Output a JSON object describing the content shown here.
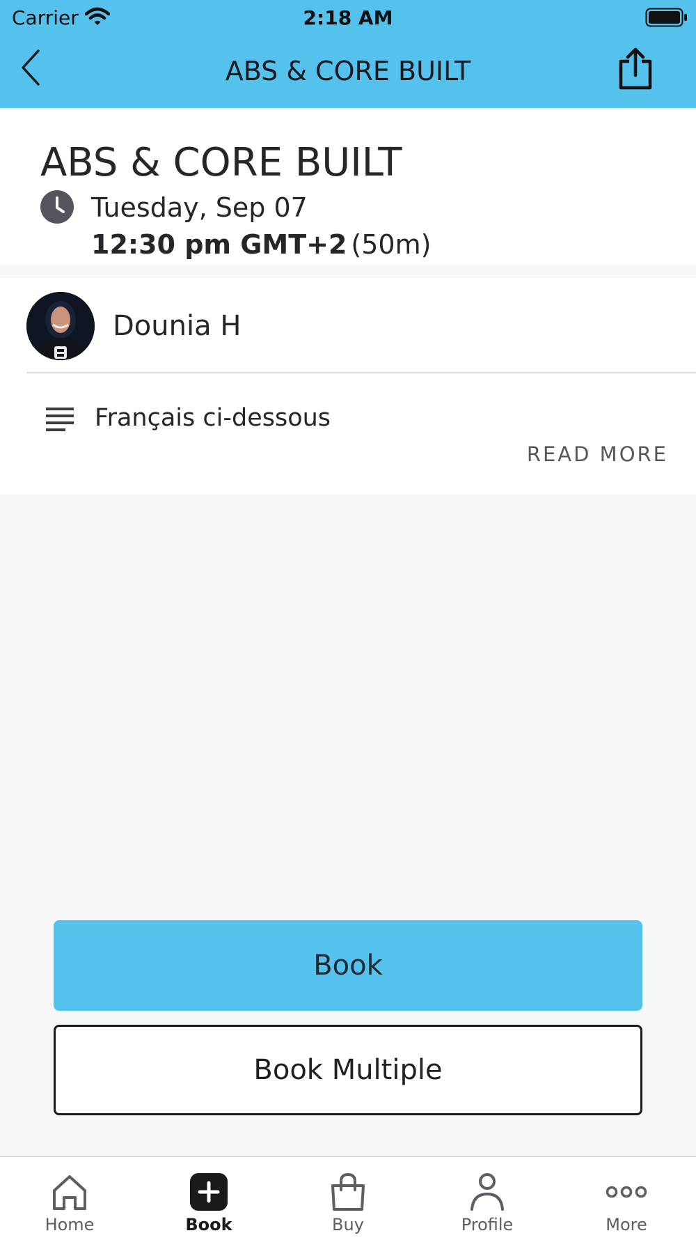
{
  "status_bar": {
    "carrier": "Carrier",
    "time": "2:18 AM",
    "icons": [
      "wifi-icon",
      "battery-icon"
    ]
  },
  "nav": {
    "back_icon": "chevron-left-icon",
    "title": "ABS & CORE BUILT",
    "share_icon": "share-icon"
  },
  "class_info": {
    "title": "ABS & CORE BUILT",
    "date": "Tuesday, Sep 07",
    "time": "12:30 pm GMT+2",
    "duration": "(50m)"
  },
  "instructor": {
    "name": "Dounia H"
  },
  "description": {
    "icon": "text-lines-icon",
    "text": "Français ci-dessous",
    "read_more": "READ MORE"
  },
  "actions": {
    "book": "Book",
    "book_multiple": "Book Multiple"
  },
  "tab_bar": {
    "active": "Book",
    "tabs": [
      {
        "label": "Home",
        "icon": "home-icon"
      },
      {
        "label": "Book",
        "icon": "plus-square-icon"
      },
      {
        "label": "Buy",
        "icon": "shopping-bag-icon"
      },
      {
        "label": "Profile",
        "icon": "person-icon"
      },
      {
        "label": "More",
        "icon": "more-dots-icon"
      }
    ]
  },
  "colors": {
    "accent": "#54c2ec",
    "background": "#f6f7f9",
    "text": "#25252a"
  }
}
